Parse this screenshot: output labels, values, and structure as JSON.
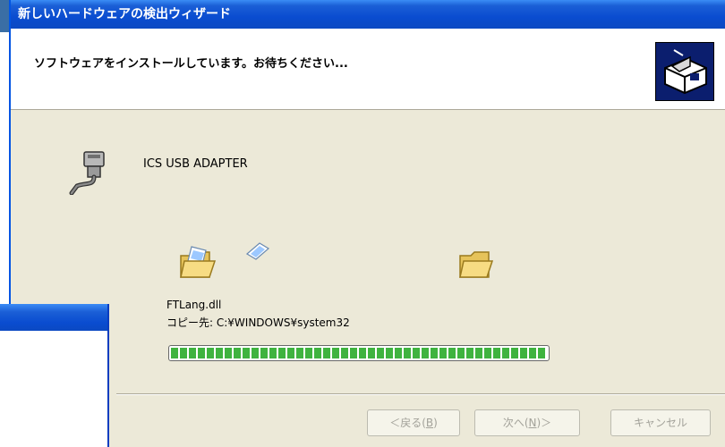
{
  "window": {
    "title": "新しいハードウェアの検出ウィザード"
  },
  "header": {
    "title": "ソフトウェアをインストールしています。お待ちください..."
  },
  "device": {
    "name": "ICS USB ADAPTER",
    "icon": "usb-cable-icon"
  },
  "copy": {
    "file": "FTLang.dll",
    "target": "コピー先: C:¥WINDOWS¥system32"
  },
  "progress": {
    "value": 1.0
  },
  "buttons": {
    "back": "＜戻る(",
    "back_key": "B",
    "back_end": ")",
    "next": "次へ(",
    "next_key": "N",
    "next_end": ")＞",
    "cancel": "キャンセル"
  },
  "colors": {
    "titlebar": "#0a4cd0",
    "progress": "#3fb33f",
    "panel": "#ece9d8"
  }
}
